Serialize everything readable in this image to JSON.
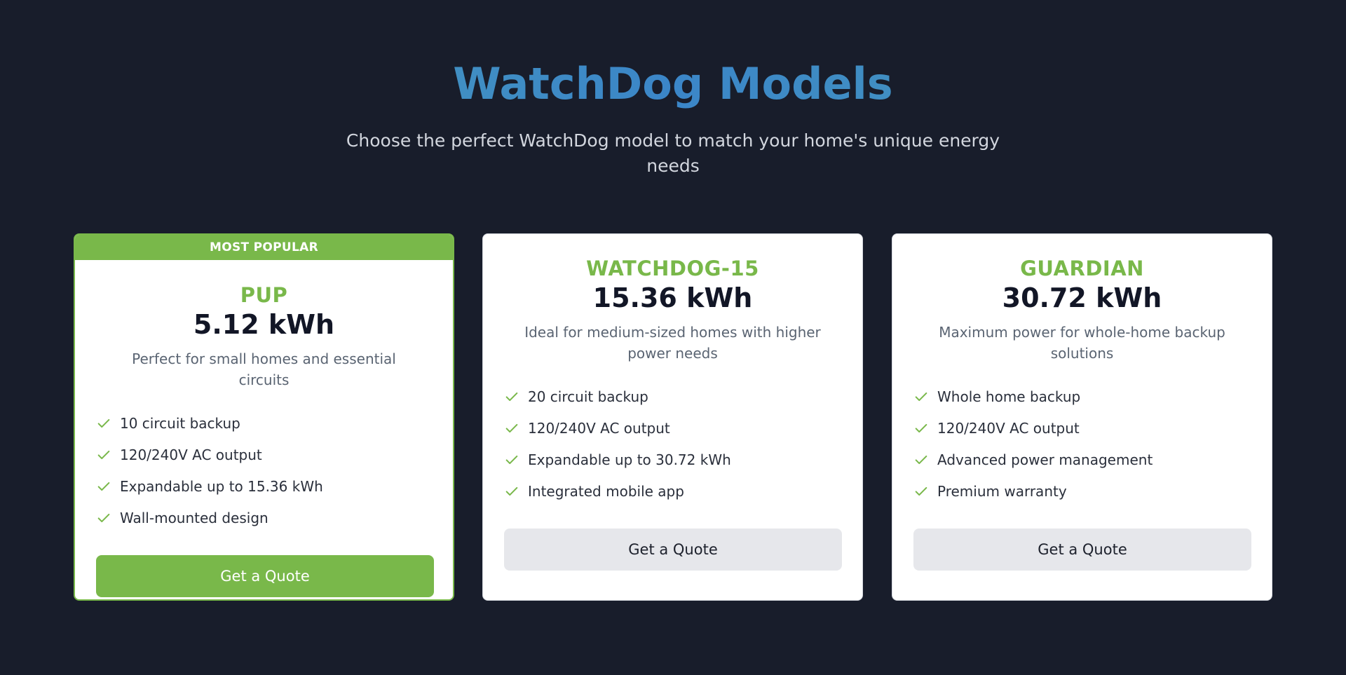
{
  "header": {
    "title": "WatchDog Models",
    "subtitle": "Choose the perfect WatchDog model to match your home's unique energy needs"
  },
  "colors": {
    "background": "#181d2b",
    "accent_green": "#79b84a",
    "title_blue": "#3b86c8"
  },
  "cards": [
    {
      "badge": "MOST POPULAR",
      "name": "PUP",
      "capacity": "5.12 kWh",
      "description": "Perfect for small homes and essential circuits",
      "features": [
        "10 circuit backup",
        "120/240V AC output",
        "Expandable up to 15.36 kWh",
        "Wall-mounted design"
      ],
      "button_label": "Get a Quote"
    },
    {
      "name": "WATCHDOG-15",
      "capacity": "15.36 kWh",
      "description": "Ideal for medium-sized homes with higher power needs",
      "features": [
        "20 circuit backup",
        "120/240V AC output",
        "Expandable up to 30.72 kWh",
        "Integrated mobile app"
      ],
      "button_label": "Get a Quote"
    },
    {
      "name": "GUARDIAN",
      "capacity": "30.72 kWh",
      "description": "Maximum power for whole-home backup solutions",
      "features": [
        "Whole home backup",
        "120/240V AC output",
        "Advanced power management",
        "Premium warranty"
      ],
      "button_label": "Get a Quote"
    }
  ]
}
